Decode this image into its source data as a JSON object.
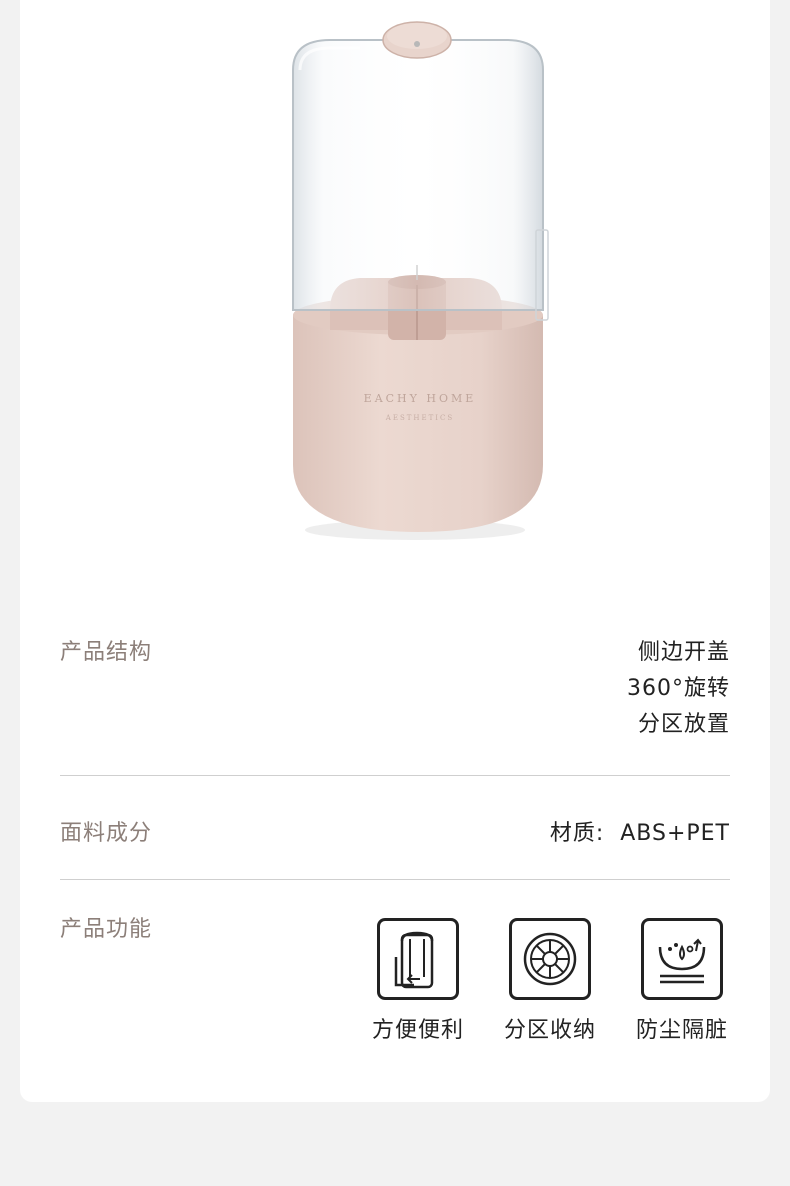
{
  "product": {
    "brand_line1": "EACHY HOME",
    "brand_line2": "AESTHETICS",
    "colors": {
      "base": "#e8d4cc",
      "accent": "#d8bdb4",
      "cover": "#eef2f5"
    }
  },
  "specs": {
    "structure": {
      "label": "产品结构",
      "values": [
        "侧边开盖",
        "360°旋转",
        "分区放置"
      ]
    },
    "material": {
      "label": "面料成分",
      "value": "材质:  ABS+PET"
    },
    "functions": {
      "label": "产品功能",
      "items": [
        {
          "icon": "side-open-icon",
          "label": "方便便利"
        },
        {
          "icon": "compartment-wheel-icon",
          "label": "分区收纳"
        },
        {
          "icon": "dust-proof-icon",
          "label": "防尘隔脏"
        }
      ]
    }
  }
}
